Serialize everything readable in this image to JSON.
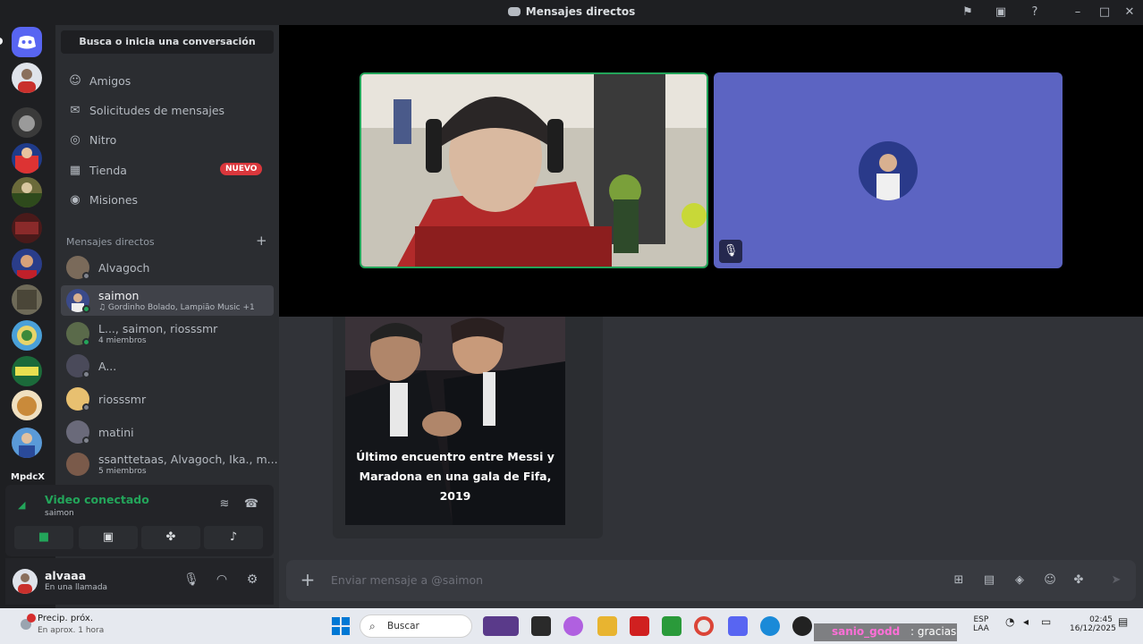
{
  "window": {
    "title": "Mensajes directos"
  },
  "titlebar_icons": [
    "inbox-flag-icon",
    "screen-share-icon",
    "help-icon",
    "minimize-icon",
    "maximize-icon",
    "close-icon"
  ],
  "guilds": {
    "label": "MpdcX"
  },
  "sidebar": {
    "search_placeholder": "Busca o inicia una conversación",
    "nav": [
      {
        "label": "Amigos",
        "icon": "friends-icon"
      },
      {
        "label": "Solicitudes de mensajes",
        "icon": "message-requests-icon"
      },
      {
        "label": "Nitro",
        "icon": "nitro-icon"
      },
      {
        "label": "Tienda",
        "icon": "shop-icon",
        "badge": "NUEVO"
      },
      {
        "label": "Misiones",
        "icon": "quests-icon"
      }
    ],
    "dm_header": "Mensajes directos",
    "dms": [
      {
        "name": "Alvagoch",
        "sub": "",
        "online": false
      },
      {
        "name": "saimon",
        "sub": "♫ Gordinho Bolado, Lampião Music +1",
        "online": true,
        "active": true
      },
      {
        "name": "L..., saimon, riosssmr",
        "sub": "4 miembros",
        "online": false
      },
      {
        "name": "A...",
        "sub": "",
        "online": false
      },
      {
        "name": "riosssmr",
        "sub": "",
        "online": false
      },
      {
        "name": "matini",
        "sub": "",
        "online": false
      },
      {
        "name": "ssanttetaas, Alvagoch, Ika., m...",
        "sub": "5 miembros",
        "online": false
      }
    ]
  },
  "voice": {
    "title": "Video conectado",
    "channel": "saimon"
  },
  "user": {
    "name": "alvaaa",
    "status": "En una llamada"
  },
  "chat": {
    "embed_caption": "Último encuentro entre Messi y Maradona en una gala de Fifa, 2019",
    "composer_placeholder": "Enviar mensaje a @saimon"
  },
  "taskbar": {
    "weather_line1": "Precip. próx.",
    "weather_line2": "En aprox. 1 hora",
    "search_label": "Buscar",
    "lang": "ESP",
    "lang2": "LAA",
    "time": "02:45",
    "date": "16/12/2025"
  },
  "stream_overlay": {
    "user": "sanio_godd",
    "message": ": gracias"
  },
  "colors": {
    "accent": "#5865f2",
    "online": "#23a55a",
    "badge": "#da373c",
    "tile_bg": "#5c64c2"
  }
}
